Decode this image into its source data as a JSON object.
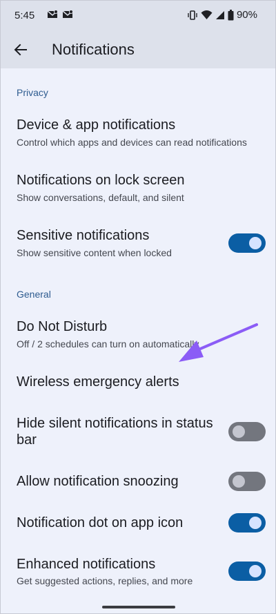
{
  "status_bar": {
    "time": "5:45",
    "left_icons": [
      "mail-icon",
      "mail-icon"
    ],
    "right_icons": [
      "vibrate-icon",
      "wifi-icon",
      "signal-icon",
      "battery-icon"
    ],
    "battery_percent": "90%"
  },
  "app_bar": {
    "title": "Notifications",
    "back_icon": "arrow-left-icon"
  },
  "sections": [
    {
      "header": "Privacy",
      "items": [
        {
          "title": "Device & app notifications",
          "summary": "Control which apps and devices can read notifications"
        },
        {
          "title": "Notifications on lock screen",
          "summary": "Show conversations, default, and silent"
        },
        {
          "title": "Sensitive notifications",
          "summary": "Show sensitive content when locked",
          "toggle": true
        }
      ]
    },
    {
      "header": "General",
      "items": [
        {
          "title": "Do Not Disturb",
          "summary": "Off / 2 schedules can turn on automatically"
        },
        {
          "title": "Wireless emergency alerts"
        },
        {
          "title": "Hide silent notifications in status bar",
          "toggle": false
        },
        {
          "title": "Allow notification snoozing",
          "toggle": false
        },
        {
          "title": "Notification dot on app icon",
          "toggle": true
        },
        {
          "title": "Enhanced notifications",
          "summary": "Get suggested actions, replies, and more",
          "toggle": true
        }
      ]
    }
  ],
  "colors": {
    "toggle_on": "#0b5ea4",
    "toggle_off": "#73767e",
    "section_header": "#2d5b8f",
    "annotation_arrow": "#8b5cf6"
  }
}
